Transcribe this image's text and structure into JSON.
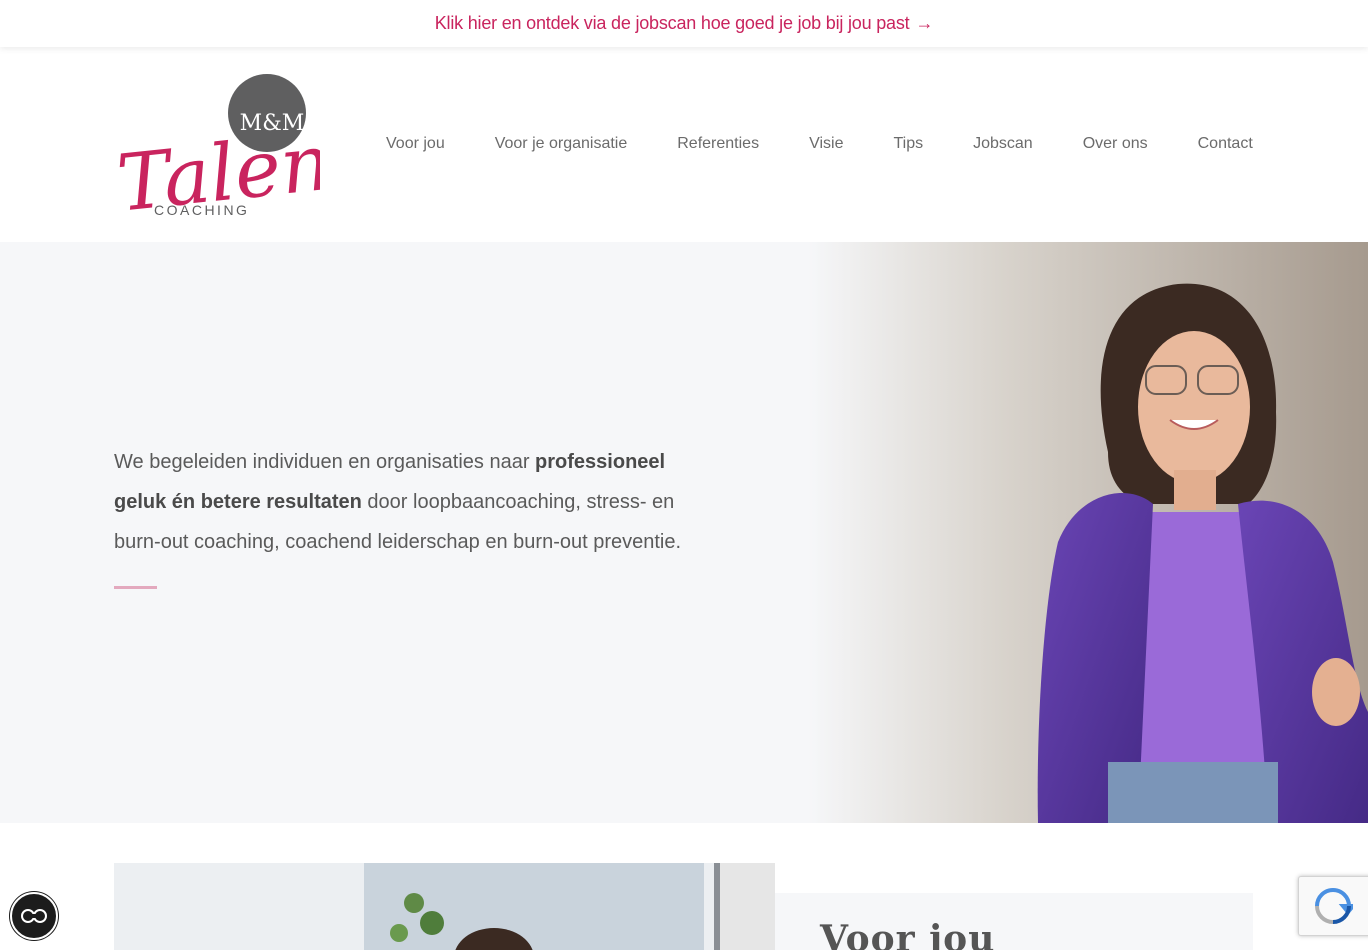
{
  "announcement": {
    "text": "Klik hier en ontdek via de jobscan hoe goed je job bij jou past",
    "arrow": "→"
  },
  "logo": {
    "monogram": "M&M",
    "script": "Talent",
    "subtitle": "COACHING"
  },
  "nav": {
    "items": [
      {
        "label": "Voor jou"
      },
      {
        "label": "Voor je organisatie"
      },
      {
        "label": "Referenties"
      },
      {
        "label": "Visie"
      },
      {
        "label": "Tips"
      },
      {
        "label": "Jobscan"
      },
      {
        "label": "Over ons"
      },
      {
        "label": "Contact"
      }
    ]
  },
  "hero": {
    "text_pre": "We begeleiden individuen en organisaties naar ",
    "text_bold": "professioneel geluk én betere resultaten",
    "text_post": " door loopbaancoaching, stress- en burn-out coaching, coachend leiderschap en burn-out preventie."
  },
  "section2": {
    "title": "Voor jou"
  },
  "colors": {
    "accent": "#c9245e",
    "hero_bg": "#f6f7f9",
    "divider": "#e3a9be",
    "jacket": "#5b3aa0"
  },
  "icons": {
    "accessibility": "accessibility-toggle-icon",
    "recaptcha": "recaptcha-icon"
  }
}
